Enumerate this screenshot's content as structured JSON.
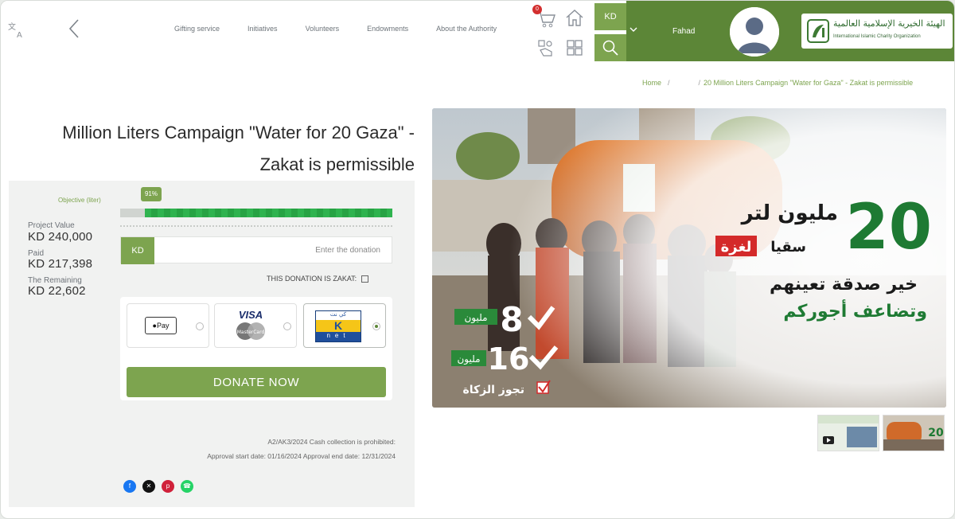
{
  "header": {
    "nav": [
      "Gifting service",
      "Initiatives",
      "Volunteers",
      "Endowments",
      "About the Authority"
    ],
    "cart_count": "0",
    "currency": "KD",
    "user_name": "Fahad",
    "logo_ar": "الهيئة الخيرية الإسلامية العالمية",
    "logo_en": "International Islamic Charity Organization"
  },
  "breadcrumb": {
    "home": "Home",
    "current": "20 Million Liters Campaign \"Water for Gaza\" - Zakat is permissible"
  },
  "title": "Million Liters Campaign \"Water for 20 Gaza\" - Zakat is permissible",
  "stats": {
    "project_value_label": "Project Value",
    "project_value": "KD  240,000",
    "paid_label": "Paid",
    "paid": "KD  217,398",
    "remaining_label": "The Remaining",
    "remaining": "KD  22,602"
  },
  "progress": {
    "objective_label": "Objective (liter)",
    "percent_label": "91%",
    "percent": 91
  },
  "donation": {
    "currency": "KD",
    "placeholder": "Enter the donation",
    "zakat_label": "THIS DONATION IS ZAKAT:",
    "payment_methods": [
      "Apple Pay",
      "VISA",
      "KNET"
    ],
    "selected_method": "KNET",
    "apple_pay_text": "Pay",
    "visa_text": "VISA",
    "mastercard_text": "MasterCard",
    "knet_top": "كي نت",
    "knet_k": "K",
    "knet_bottom": "net",
    "button": "DONATE NOW"
  },
  "notes": {
    "license": "A2/AK3/2024 Cash collection is prohibited:",
    "dates": "Approval start date: 01/16/2024 Approval end date: 12/31/2024"
  },
  "social": [
    "facebook",
    "x",
    "pinterest",
    "whatsapp"
  ],
  "hero": {
    "big_number": "20",
    "million_liter": "مليون لتر",
    "water_for": "سقيا",
    "gaza": "لغزة",
    "line1": "خير صدقة تعينهم",
    "line2": "وتضاعف أجوركم",
    "milestone1_num": "8",
    "milestone1_unit": "مليون",
    "milestone2_num": "16",
    "milestone2_unit": "مليون",
    "zakat_permitted": "تجوز الزكاة",
    "thumb_number": "20"
  },
  "colors": {
    "brand_green": "#5c8637",
    "accent_green": "#7da44f",
    "progress_green": "#2fb34f"
  }
}
